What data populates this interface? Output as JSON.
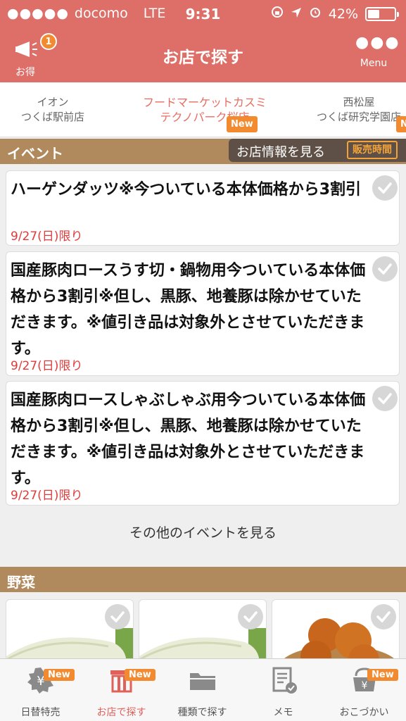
{
  "status_bar": {
    "carrier": "docomo",
    "network": "LTE",
    "time": "9:31",
    "battery": "42%"
  },
  "nav": {
    "deals_label": "お得",
    "deals_count": "1",
    "title": "お店で探す",
    "menu_label": "Menu"
  },
  "store_tabs": [
    {
      "line1": "イオン",
      "line2": "つくば駅前店"
    },
    {
      "line1": "フードマーケットカスミ",
      "line2": "テクノパーク桜店",
      "badge": "New"
    },
    {
      "line1": "西松屋",
      "line2": "つくば研究学園店",
      "badge": "N"
    }
  ],
  "event_header": {
    "title": "イベント",
    "store_info": "お店情報を見る",
    "hours": "販売時間"
  },
  "events": [
    {
      "title": "ハーゲンダッツ※今ついている本体価格から3割引",
      "date": "9/27(日)限り"
    },
    {
      "title": "国産豚肉ロースうす切・鍋物用今ついている本体価格から3割引※但し、黒豚、地養豚は除かせていただきます。※値引き品は対象外とさせていただきます。",
      "date": "9/27(日)限り"
    },
    {
      "title": "国産豚肉ロースしゃぶしゃぶ用今ついている本体価格から3割引※但し、黒豚、地養豚は除かせていただきます。※値引き品は対象外とさせていただきます。",
      "date": "9/27(日)限り"
    }
  ],
  "more_events": "その他のイベントを見る",
  "veg_section": {
    "title": "野菜"
  },
  "tabbar": [
    {
      "label": "日替特売",
      "badge": "New"
    },
    {
      "label": "お店で探す",
      "badge": "New"
    },
    {
      "label": "種類で探す"
    },
    {
      "label": "メモ"
    },
    {
      "label": "おこづかい",
      "badge": "New"
    }
  ],
  "colors": {
    "header": "#dd6f68",
    "accent": "#ea6b62",
    "badge": "#f28a30",
    "section": "#b08a5d",
    "date": "#e03a3a"
  }
}
